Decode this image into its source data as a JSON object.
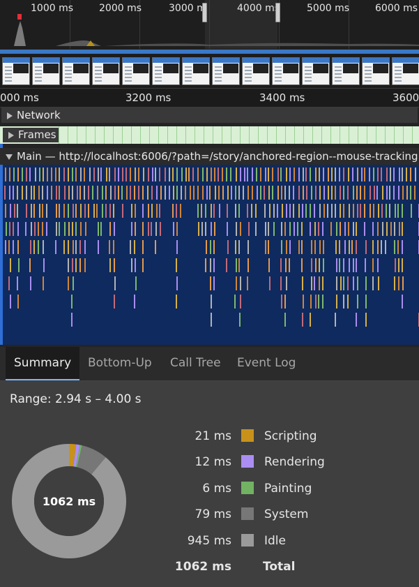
{
  "overview": {
    "ticks": [
      "1000 ms",
      "2000 ms",
      "3000 m",
      "4000 ms",
      "5000 ms",
      "6000 ms"
    ]
  },
  "ruler": {
    "ticks": [
      "000 ms",
      "3200 ms",
      "3400 ms",
      "3600"
    ]
  },
  "tracks": {
    "network_label": "Network",
    "frames_label": "Frames",
    "main_label": "Main — http://localhost:6006/?path=/story/anchored-region--mouse-tracking"
  },
  "tabs": [
    "Summary",
    "Bottom-Up",
    "Call Tree",
    "Event Log"
  ],
  "summary": {
    "range": "Range: 2.94 s – 4.00 s",
    "total_center": "1062 ms",
    "rows": [
      {
        "value": "21 ms",
        "name": "Scripting",
        "color": "#c8921a"
      },
      {
        "value": "12 ms",
        "name": "Rendering",
        "color": "#ab8ef2"
      },
      {
        "value": "6 ms",
        "name": "Painting",
        "color": "#71b363"
      },
      {
        "value": "79 ms",
        "name": "System",
        "color": "#777777"
      },
      {
        "value": "945 ms",
        "name": "Idle",
        "color": "#9a9a9a"
      }
    ],
    "total": {
      "value": "1062 ms",
      "name": "Total"
    }
  },
  "chart_data": {
    "type": "pie",
    "title": "",
    "categories": [
      "Scripting",
      "Rendering",
      "Painting",
      "System",
      "Idle"
    ],
    "values": [
      21,
      12,
      6,
      79,
      945
    ],
    "colors": [
      "#c8921a",
      "#ab8ef2",
      "#71b363",
      "#777777",
      "#9a9a9a"
    ],
    "center_label": "1062 ms"
  }
}
